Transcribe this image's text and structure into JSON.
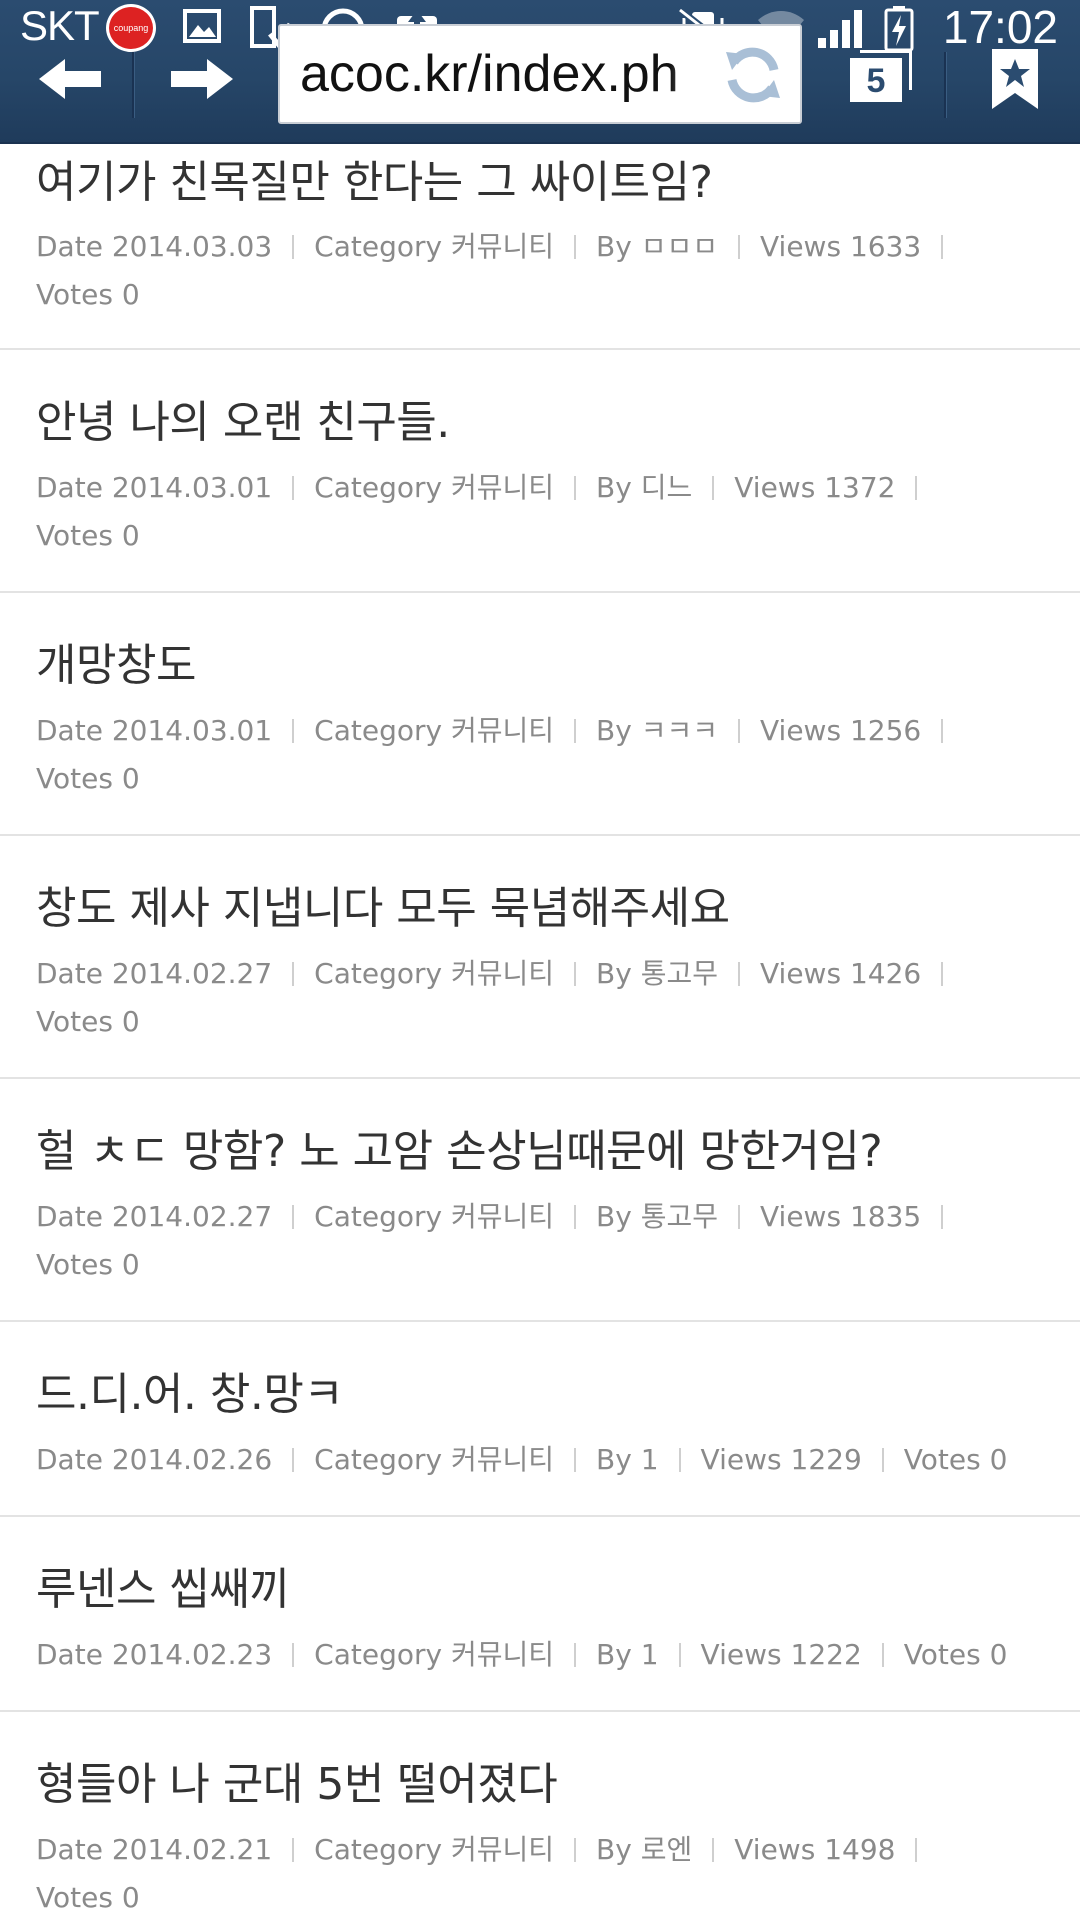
{
  "status_bar": {
    "carrier": "SKT",
    "coupang_badge": "coupang",
    "time": "17:02"
  },
  "browser": {
    "url": "acoc.kr/index.ph",
    "tab_count": "5"
  },
  "posts": [
    {
      "title": "여기가 친목질만 한다는 그 싸이트임?",
      "date_label": "Date",
      "date": "2014.03.03",
      "category_label": "Category",
      "category": "커뮤니티",
      "by_label": "By",
      "author": "ㅁㅁㅁ",
      "views_label": "Views",
      "views": "1633",
      "votes_label": "Votes",
      "votes": "0"
    },
    {
      "title": "안녕 나의 오랜 친구들.",
      "date_label": "Date",
      "date": "2014.03.01",
      "category_label": "Category",
      "category": "커뮤니티",
      "by_label": "By",
      "author": "디느",
      "views_label": "Views",
      "views": "1372",
      "votes_label": "Votes",
      "votes": "0"
    },
    {
      "title": "개망창도",
      "date_label": "Date",
      "date": "2014.03.01",
      "category_label": "Category",
      "category": "커뮤니티",
      "by_label": "By",
      "author": "ㅋㅋㅋ",
      "views_label": "Views",
      "views": "1256",
      "votes_label": "Votes",
      "votes": "0"
    },
    {
      "title": "창도 제사 지냅니다 모두 묵념해주세요",
      "date_label": "Date",
      "date": "2014.02.27",
      "category_label": "Category",
      "category": "커뮤니티",
      "by_label": "By",
      "author": "통고무",
      "views_label": "Views",
      "views": "1426",
      "votes_label": "Votes",
      "votes": "0"
    },
    {
      "title": "헐 ㅊㄷ 망함? 노 고암 손상님때문에 망한거임?",
      "date_label": "Date",
      "date": "2014.02.27",
      "category_label": "Category",
      "category": "커뮤니티",
      "by_label": "By",
      "author": "통고무",
      "views_label": "Views",
      "views": "1835",
      "votes_label": "Votes",
      "votes": "0"
    },
    {
      "title": "드.디.어. 창.망ㅋ",
      "date_label": "Date",
      "date": "2014.02.26",
      "category_label": "Category",
      "category": "커뮤니티",
      "by_label": "By",
      "author": "1",
      "views_label": "Views",
      "views": "1229",
      "votes_label": "Votes",
      "votes": "0"
    },
    {
      "title": "루넨스 씹쌔끼",
      "date_label": "Date",
      "date": "2014.02.23",
      "category_label": "Category",
      "category": "커뮤니티",
      "by_label": "By",
      "author": "1",
      "views_label": "Views",
      "views": "1222",
      "votes_label": "Votes",
      "votes": "0"
    },
    {
      "title": "형들아 나 군대 5번 떨어졌다",
      "date_label": "Date",
      "date": "2014.02.21",
      "category_label": "Category",
      "category": "커뮤니티",
      "by_label": "By",
      "author": "로엔",
      "views_label": "Views",
      "views": "1498",
      "votes_label": "Votes",
      "votes": "0"
    }
  ]
}
